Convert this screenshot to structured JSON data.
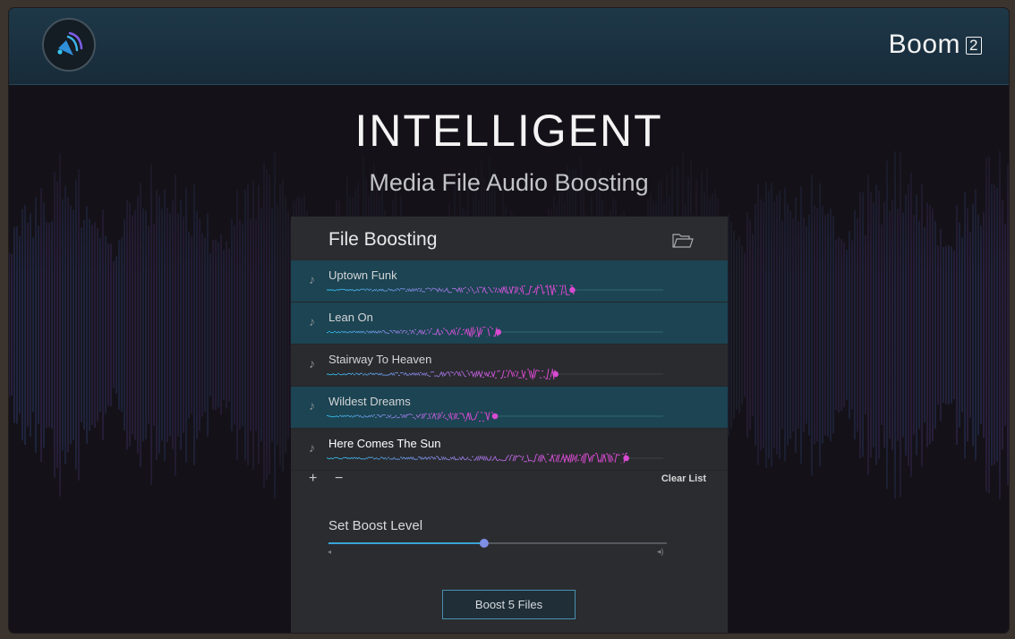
{
  "header": {
    "brand_name": "Boom",
    "brand_version": "2",
    "logo_icon": "speaker-waves-logo-icon"
  },
  "hero": {
    "title": "INTELLIGENT",
    "subtitle": "Media File Audio Boosting"
  },
  "panel": {
    "title": "File Boosting",
    "folder_icon": "folder-icon",
    "tracks": [
      {
        "name": "Uptown Funk",
        "boost": 0.73,
        "selected": true,
        "active": false
      },
      {
        "name": "Lean On",
        "boost": 0.51,
        "selected": true,
        "active": false
      },
      {
        "name": "Stairway To Heaven",
        "boost": 0.68,
        "selected": false,
        "active": false
      },
      {
        "name": "Wildest Dreams",
        "boost": 0.5,
        "selected": true,
        "active": false
      },
      {
        "name": "Here Comes The Sun",
        "boost": 0.89,
        "selected": false,
        "active": true
      }
    ],
    "add_label": "+",
    "remove_label": "−",
    "clear_label": "Clear List",
    "boost_level_label": "Set Boost Level",
    "boost_level": 0.46,
    "volume_low_icon": "speaker-low-icon",
    "volume_high_icon": "speaker-high-icon",
    "boost_button_label": "Boost 5 Files"
  },
  "colors": {
    "accent_cyan": "#2fb3dc",
    "accent_magenta": "#d84ad0",
    "selected_row": "#1c4452",
    "panel_bg": "#2b2c30"
  }
}
